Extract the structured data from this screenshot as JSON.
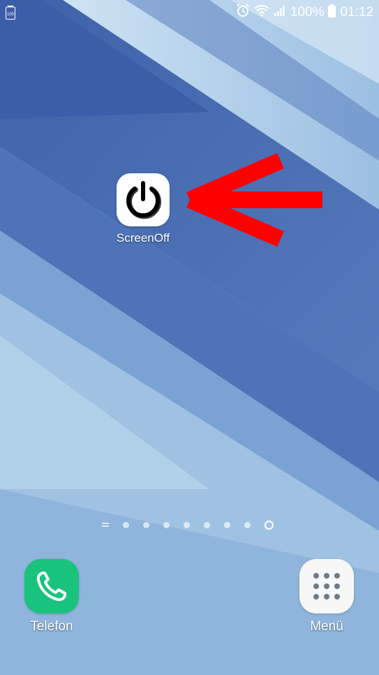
{
  "status_bar": {
    "battery_small_label": "100",
    "battery_percent": "100%",
    "time": "01:12",
    "icons": [
      "alarm-icon",
      "wifi-icon",
      "signal-icon",
      "battery-icon"
    ]
  },
  "home": {
    "apps": [
      {
        "label": "ScreenOff",
        "icon": "power-icon"
      }
    ],
    "annotation": {
      "icon": "red-arrow-icon",
      "color": "#ff0000"
    }
  },
  "page_indicator": {
    "pages": 8,
    "active_index": 7
  },
  "dock": {
    "apps": [
      {
        "label": "Telefon",
        "icon": "phone-icon",
        "color": "#19c37d"
      },
      {
        "label": "Menü",
        "icon": "apps-grid-icon",
        "color": "#f7f7f7"
      }
    ]
  },
  "colors": {
    "wallpaper_dark": "#3f64a8",
    "wallpaper_light": "#a9cce9"
  }
}
